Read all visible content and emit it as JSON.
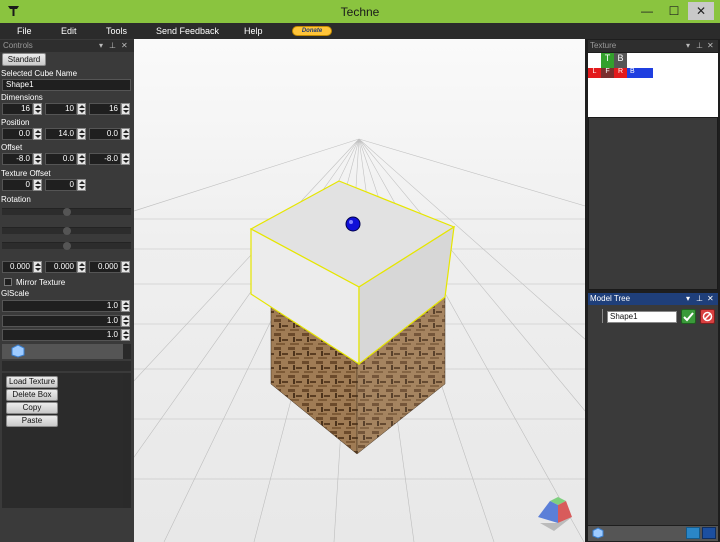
{
  "window": {
    "title": "Techne",
    "minimize": "—",
    "maximize": "☐",
    "close": "✕"
  },
  "menu": {
    "file": "File",
    "edit": "Edit",
    "tools": "Tools",
    "feedback": "Send Feedback",
    "help": "Help",
    "donate": "Donate"
  },
  "controls": {
    "title": "Controls",
    "standard": "Standard",
    "selected_cube_label": "Selected Cube Name",
    "selected_cube_name": "Shape1",
    "dimensions_label": "Dimensions",
    "dimensions": [
      "16",
      "10",
      "16"
    ],
    "position_label": "Position",
    "position": [
      "0.0",
      "14.0",
      "0.0"
    ],
    "offset_label": "Offset",
    "offset": [
      "-8.0",
      "0.0",
      "-8.0"
    ],
    "texture_offset_label": "Texture Offset",
    "texture_offset": [
      "0",
      "0"
    ],
    "rotation_label": "Rotation",
    "rotation": [
      "0.000",
      "0.000",
      "0.000"
    ],
    "mirror_texture": "Mirror Texture",
    "glscale_label": "GlScale",
    "glscale": [
      "1.0",
      "1.0",
      "1.0"
    ],
    "load_texture": "Load Texture",
    "delete_box": "Delete Box",
    "copy": "Copy",
    "paste": "Paste"
  },
  "texture": {
    "title": "Texture",
    "faces": [
      "T",
      "B",
      "L",
      "F",
      "R",
      "B"
    ],
    "colors": {
      "top": "#33a02c",
      "bottom": "#555555",
      "left": "#e31a1c",
      "front": "#7a2e2e",
      "right": "#e31a1c",
      "back": "#1f3fe0"
    }
  },
  "model_tree": {
    "title": "Model Tree",
    "items": [
      {
        "name": "Shape1"
      }
    ]
  },
  "icons": [
    "app-icon",
    "pin-icon",
    "close-icon",
    "dropdown-icon",
    "check-icon",
    "delete-icon",
    "nav-cube-icon"
  ]
}
